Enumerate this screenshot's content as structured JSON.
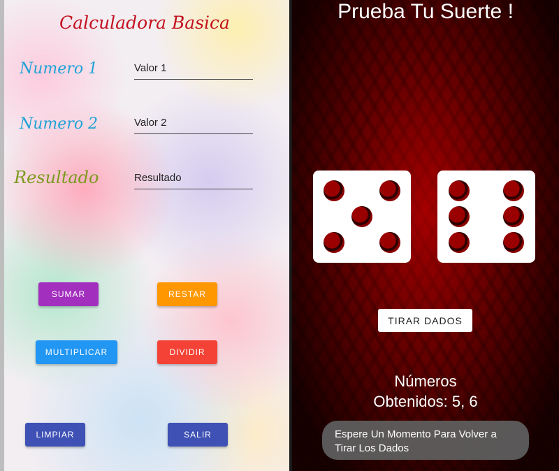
{
  "calculator": {
    "title": "Calculadora Basica",
    "labels": {
      "numero1": "Numero 1",
      "numero2": "Numero 2",
      "resultado": "Resultado"
    },
    "fields": {
      "valor1_hint": "Valor 1",
      "valor2_hint": "Valor 2",
      "resultado_hint": "Resultado"
    },
    "buttons": {
      "sumar": "SUMAR",
      "restar": "RESTAR",
      "multiplicar": "MULTIPLICAR",
      "dividir": "DIVIDIR",
      "limpiar": "LIMPIAR",
      "salir": "SALIR"
    },
    "colors": {
      "title": "#c2101e",
      "label_numero": "#1fa3d6",
      "label_resultado": "#7a9a1e",
      "sumar": "#a32fbf",
      "restar": "#ff9800",
      "multiplicar": "#2196f3",
      "dividir": "#f44336",
      "limpiar": "#3f51b5",
      "salir": "#3f51b5"
    }
  },
  "dice_game": {
    "title": "Prueba Tu Suerte !",
    "dice": [
      {
        "value": 5
      },
      {
        "value": 6
      }
    ],
    "roll_button": "TIRAR DADOS",
    "result_line1": "Números",
    "result_line2": "Obtenidos: 5, 6",
    "toast": "Espere Un Momento Para Volver a Tirar Los Dados"
  }
}
